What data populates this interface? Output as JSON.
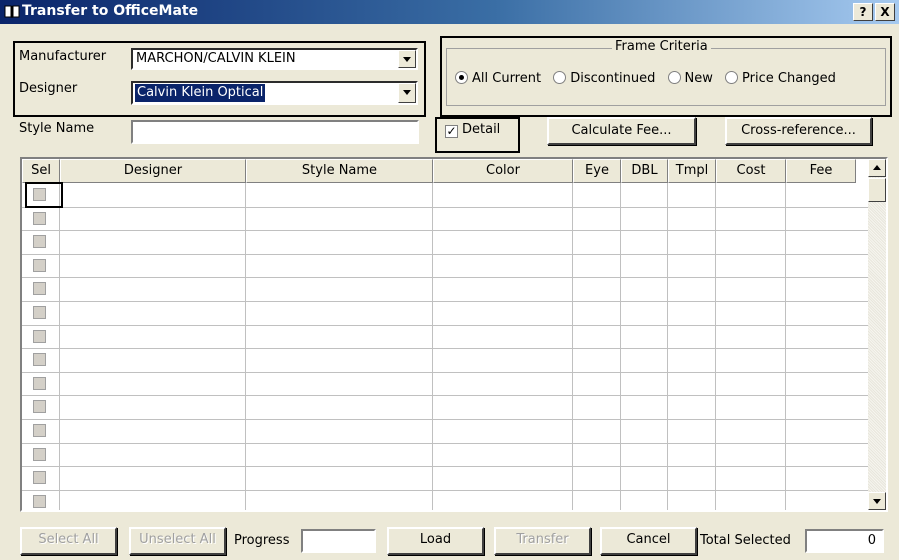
{
  "window": {
    "title": "Transfer to OfficeMate",
    "help_label": "?",
    "close_label": "X"
  },
  "filters": {
    "manufacturer_label": "Manufacturer",
    "manufacturer_value": "MARCHON/CALVIN KLEIN",
    "designer_label": "Designer",
    "designer_value": "Calvin Klein Optical",
    "style_name_label": "Style Name",
    "style_name_value": ""
  },
  "frame_criteria": {
    "title": "Frame Criteria",
    "options": [
      "All Current",
      "Discontinued",
      "New",
      "Price Changed"
    ],
    "selected": "All Current"
  },
  "detail": {
    "label": "Detail",
    "checked": true
  },
  "buttons": {
    "calculate_fee": "Calculate Fee...",
    "cross_reference": "Cross-reference...",
    "select_all": "Select All",
    "unselect_all": "Unselect All",
    "load": "Load",
    "transfer": "Transfer",
    "cancel": "Cancel"
  },
  "grid": {
    "columns": [
      "Sel",
      "Designer",
      "Style Name",
      "Color",
      "Eye",
      "DBL",
      "Tmpl",
      "Cost",
      "Fee"
    ],
    "visible_rows": 14
  },
  "footer": {
    "progress_label": "Progress",
    "total_selected_label": "Total Selected",
    "total_selected_value": "0"
  },
  "colors": {
    "title_start": "#0a246a",
    "title_end": "#a6caf0",
    "selection": "#0a246a",
    "face": "#ece9d8"
  }
}
